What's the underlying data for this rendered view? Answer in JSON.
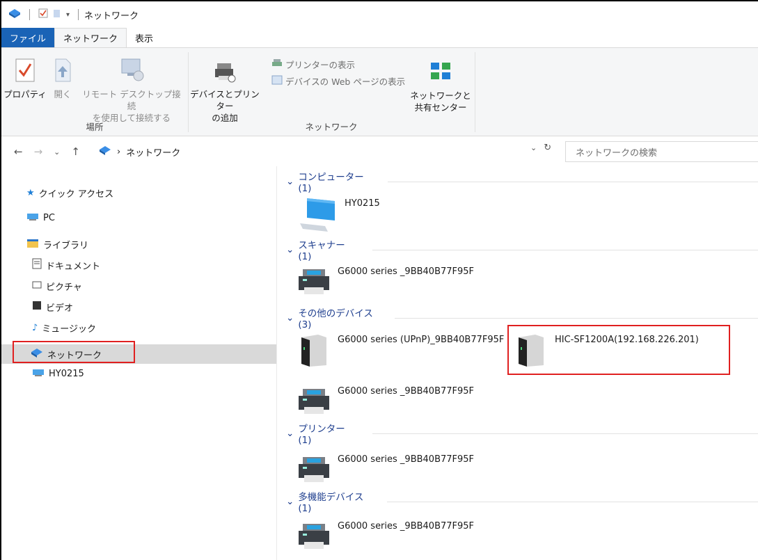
{
  "window": {
    "title": "ネットワーク"
  },
  "ribbon": {
    "tabs": {
      "file": "ファイル",
      "network": "ネットワーク",
      "view": "表示"
    },
    "properties_label": "プロパティ",
    "open_label": "開く",
    "remote_desktop_label_1": "リモート デスクトップ接続",
    "remote_desktop_label_2": "を使用して接続する",
    "location_group": "場所",
    "add_devices_label_1": "デバイスとプリンター",
    "add_devices_label_2": "の追加",
    "show_printers_label": "プリンターの表示",
    "show_web_page_label": "デバイスの Web ページの表示",
    "network_group": "ネットワーク",
    "network_center_label_1": "ネットワークと",
    "network_center_label_2": "共有センター"
  },
  "address": {
    "path": "ネットワーク",
    "search_placeholder": "ネットワークの検索"
  },
  "navpane": {
    "quick_access": "クイック アクセス",
    "pc": "PC",
    "library": "ライブラリ",
    "documents": "ドキュメント",
    "pictures": "ピクチャ",
    "videos": "ビデオ",
    "music": "ミュージック",
    "network": "ネットワーク",
    "hy0215": "HY0215"
  },
  "content": {
    "groups": {
      "computers": "コンピューター (1)",
      "scanners": "スキャナー (1)",
      "other_devices": "その他のデバイス (3)",
      "printers": "プリンター (1)",
      "multifunction": "多機能デバイス (1)"
    },
    "items": {
      "computer": "HY0215",
      "scanner": "G6000 series _9BB40B77F95F",
      "other_upnp": "G6000 series (UPnP)_9BB40B77F95F",
      "other_nas": "HIC-SF1200A(192.168.226.201)",
      "other_printer": "G6000 series _9BB40B77F95F",
      "printer": "G6000 series _9BB40B77F95F",
      "mfp": "G6000 series _9BB40B77F95F"
    }
  },
  "colors": {
    "file_tab": "#1a63b6",
    "highlight_box": "#e02020",
    "group_header": "#1e3e8e"
  }
}
